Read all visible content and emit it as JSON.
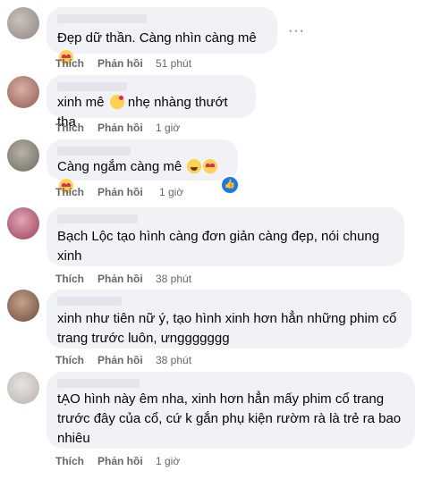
{
  "comments": [
    {
      "text": "Đẹp dữ thần. Càng nhìn càng mê",
      "emoji": [
        "heart-eyes"
      ],
      "like": "Thích",
      "reply": "Phản hồi",
      "time": "51 phút"
    },
    {
      "text": "xinh mê",
      "text_after": "nhẹ nhàng thướt tha",
      "emoji": [
        "face-blowing-kiss"
      ],
      "like": "Thích",
      "reply": "Phản hồi",
      "time": "1 giờ"
    },
    {
      "text": "Càng ngắm càng mê",
      "emoji": [
        "grinning",
        "heart-eyes",
        "heart-eyes"
      ],
      "like": "Thích",
      "reply": "Phản hồi",
      "time": "1 giờ"
    },
    {
      "text": "Bạch Lộc tạo hình càng đơn giản càng đẹp, nói chung xinh",
      "like": "Thích",
      "reply": "Phản hồi",
      "time": "38 phút"
    },
    {
      "text": "xinh như tiên nữ ý, tạo hình xinh hơn hẳn những phim cổ trang trước luôn, ưnggggggg",
      "like": "Thích",
      "reply": "Phản hồi",
      "time": "38 phút"
    },
    {
      "text": "tẠO hình này êm nha, xinh hơn hẳn mấy phim cổ trang trước đây của cổ, cứ k gắn phụ kiện rườm rà là trẻ ra bao nhiêu",
      "like": "Thích",
      "reply": "Phản hồi",
      "time": "1 giờ"
    }
  ],
  "icons": {
    "more": "more-options-icon",
    "reaction": "like-reaction-icon"
  },
  "more_glyph": "···",
  "colors": {
    "bubble": "#f0f2f5",
    "meta_text": "#65676b",
    "like_blue": "#1877f2"
  }
}
